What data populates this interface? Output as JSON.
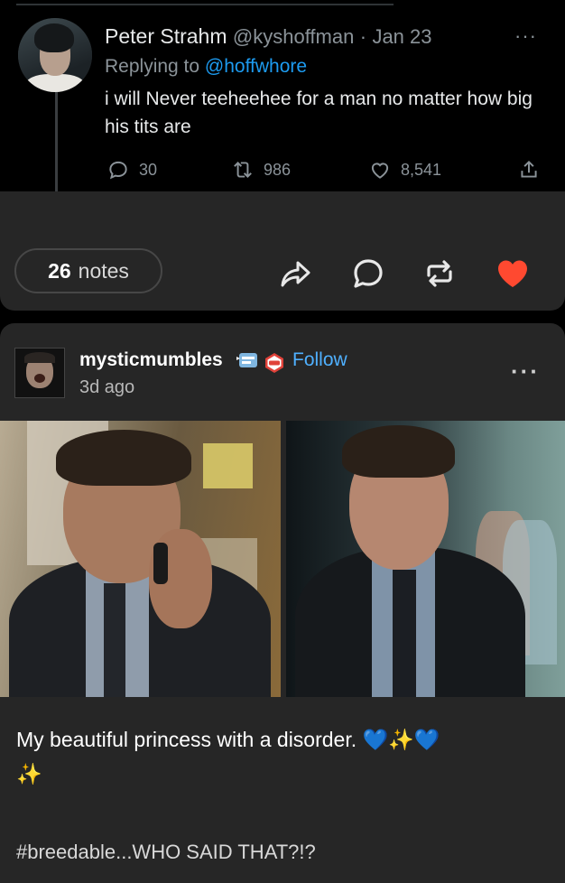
{
  "tweet": {
    "name": "Peter Strahm",
    "handle": "@kyshoffman",
    "separator": "·",
    "date": "Jan 23",
    "more": "···",
    "replying_label": "Replying to",
    "replying_handle": "@hoffwhore",
    "text": "i will Never teeheehee for a man no matter how big his tits are",
    "stats": {
      "replies": "30",
      "retweets": "986",
      "likes": "8,541"
    }
  },
  "post1": {
    "notes_count": "26",
    "notes_label": "notes",
    "icons": [
      "share-icon",
      "comment-icon",
      "reblog-icon",
      "heart-icon"
    ]
  },
  "post2": {
    "username": "mysticmumbles",
    "follow_label": "Follow",
    "time": "3d ago",
    "more": "···",
    "caption_text": "My beautiful princess with a disorder.",
    "caption_emoji_1": "💙✨💙",
    "caption_emoji_2": "✨",
    "tags": "#breedable...WHO SAID THAT?!?"
  },
  "colors": {
    "accent_blue": "#4fb0ff",
    "like_red": "#ff4930",
    "twitter_link": "#1d9bf0",
    "card_bg": "#262626"
  }
}
